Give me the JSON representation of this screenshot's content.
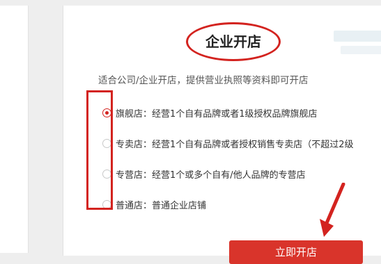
{
  "card": {
    "title": "企业开店",
    "subtitle": "适合公司/企业开店，提供营业执照等资料即可开店",
    "options": [
      {
        "label": "旗舰店：经营1个自有品牌或者1级授权品牌旗舰店",
        "checked": true
      },
      {
        "label": "专卖店：经营1个自有品牌或者授权销售专卖店（不超过2级",
        "checked": false
      },
      {
        "label": "专营店：经营1个或多个自有/他人品牌的专营店",
        "checked": false
      },
      {
        "label": "普通店：普通企业店铺",
        "checked": false
      }
    ],
    "submit_label": "立即开店"
  },
  "colors": {
    "accent": "#d3231f",
    "button": "#d9342b"
  }
}
